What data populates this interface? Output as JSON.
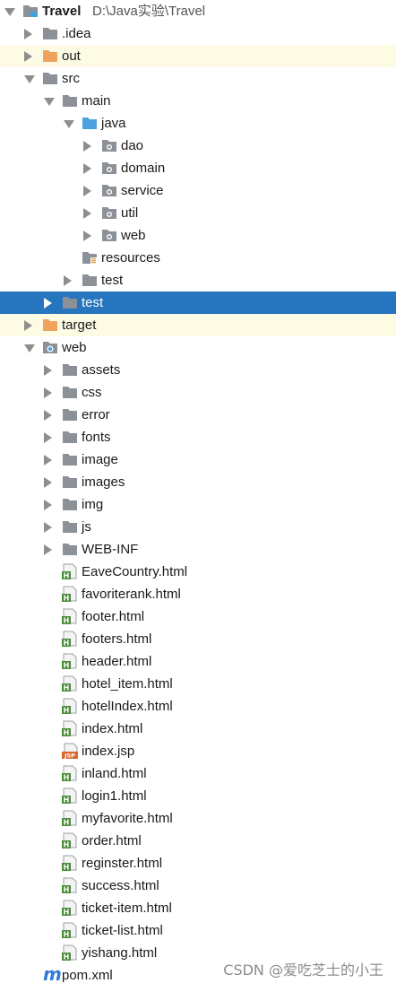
{
  "project": {
    "name": "Travel",
    "path": "D:\\Java实验\\Travel"
  },
  "tree": [
    {
      "label": "Travel",
      "indent": 0,
      "arrow": "down",
      "icon": "project",
      "bold": true,
      "path": "D:\\Java实验\\Travel"
    },
    {
      "label": ".idea",
      "indent": 1,
      "arrow": "right",
      "icon": "folder"
    },
    {
      "label": "out",
      "indent": 1,
      "arrow": "right",
      "icon": "folder-orange",
      "bg": "yellow"
    },
    {
      "label": "src",
      "indent": 1,
      "arrow": "down",
      "icon": "folder"
    },
    {
      "label": "main",
      "indent": 2,
      "arrow": "down",
      "icon": "folder"
    },
    {
      "label": "java",
      "indent": 3,
      "arrow": "down",
      "icon": "folder-blue"
    },
    {
      "label": "dao",
      "indent": 4,
      "arrow": "right",
      "icon": "package"
    },
    {
      "label": "domain",
      "indent": 4,
      "arrow": "right",
      "icon": "package"
    },
    {
      "label": "service",
      "indent": 4,
      "arrow": "right",
      "icon": "package"
    },
    {
      "label": "util",
      "indent": 4,
      "arrow": "right",
      "icon": "package"
    },
    {
      "label": "web",
      "indent": 4,
      "arrow": "right",
      "icon": "package"
    },
    {
      "label": "resources",
      "indent": 3,
      "arrow": "none",
      "icon": "folder-resources"
    },
    {
      "label": "test",
      "indent": 3,
      "arrow": "right",
      "icon": "folder"
    },
    {
      "label": "test",
      "indent": 2,
      "arrow": "right",
      "icon": "folder",
      "selected": true
    },
    {
      "label": "target",
      "indent": 1,
      "arrow": "right",
      "icon": "folder-orange",
      "bg": "yellow"
    },
    {
      "label": "web",
      "indent": 1,
      "arrow": "down",
      "icon": "folder-web"
    },
    {
      "label": "assets",
      "indent": 2,
      "arrow": "right",
      "icon": "folder"
    },
    {
      "label": "css",
      "indent": 2,
      "arrow": "right",
      "icon": "folder"
    },
    {
      "label": "error",
      "indent": 2,
      "arrow": "right",
      "icon": "folder"
    },
    {
      "label": "fonts",
      "indent": 2,
      "arrow": "right",
      "icon": "folder"
    },
    {
      "label": "image",
      "indent": 2,
      "arrow": "right",
      "icon": "folder"
    },
    {
      "label": "images",
      "indent": 2,
      "arrow": "right",
      "icon": "folder"
    },
    {
      "label": "img",
      "indent": 2,
      "arrow": "right",
      "icon": "folder"
    },
    {
      "label": "js",
      "indent": 2,
      "arrow": "right",
      "icon": "folder"
    },
    {
      "label": "WEB-INF",
      "indent": 2,
      "arrow": "right",
      "icon": "folder"
    },
    {
      "label": "EaveCountry.html",
      "indent": 2,
      "arrow": "none",
      "icon": "html-file"
    },
    {
      "label": "favoriterank.html",
      "indent": 2,
      "arrow": "none",
      "icon": "html-file"
    },
    {
      "label": "footer.html",
      "indent": 2,
      "arrow": "none",
      "icon": "html-file"
    },
    {
      "label": "footers.html",
      "indent": 2,
      "arrow": "none",
      "icon": "html-file"
    },
    {
      "label": "header.html",
      "indent": 2,
      "arrow": "none",
      "icon": "html-file"
    },
    {
      "label": "hotel_item.html",
      "indent": 2,
      "arrow": "none",
      "icon": "html-file"
    },
    {
      "label": "hotelIndex.html",
      "indent": 2,
      "arrow": "none",
      "icon": "html-file"
    },
    {
      "label": "index.html",
      "indent": 2,
      "arrow": "none",
      "icon": "html-file"
    },
    {
      "label": "index.jsp",
      "indent": 2,
      "arrow": "none",
      "icon": "jsp-file"
    },
    {
      "label": "inland.html",
      "indent": 2,
      "arrow": "none",
      "icon": "html-file"
    },
    {
      "label": "login1.html",
      "indent": 2,
      "arrow": "none",
      "icon": "html-file"
    },
    {
      "label": "myfavorite.html",
      "indent": 2,
      "arrow": "none",
      "icon": "html-file"
    },
    {
      "label": "order.html",
      "indent": 2,
      "arrow": "none",
      "icon": "html-file"
    },
    {
      "label": "reginster.html",
      "indent": 2,
      "arrow": "none",
      "icon": "html-file"
    },
    {
      "label": "success.html",
      "indent": 2,
      "arrow": "none",
      "icon": "html-file"
    },
    {
      "label": "ticket-item.html",
      "indent": 2,
      "arrow": "none",
      "icon": "html-file"
    },
    {
      "label": "ticket-list.html",
      "indent": 2,
      "arrow": "none",
      "icon": "html-file"
    },
    {
      "label": "yishang.html",
      "indent": 2,
      "arrow": "none",
      "icon": "html-file"
    },
    {
      "label": "pom.xml",
      "indent": 1,
      "arrow": "none",
      "icon": "maven-file"
    }
  ],
  "icon_texts": {
    "html": "H",
    "jsp": "JSP",
    "maven": "m"
  },
  "watermark": "CSDN @爱吃芝士的小王",
  "colors": {
    "selection": "#2675bf",
    "highlight_yellow": "#fdfbe3",
    "folder_gray": "#8b9196",
    "folder_orange": "#f0a35c",
    "folder_blue": "#4aa3df",
    "html_green": "#4b8b3b",
    "jsp_orange": "#d9682a",
    "maven_blue": "#2f7bd8"
  }
}
